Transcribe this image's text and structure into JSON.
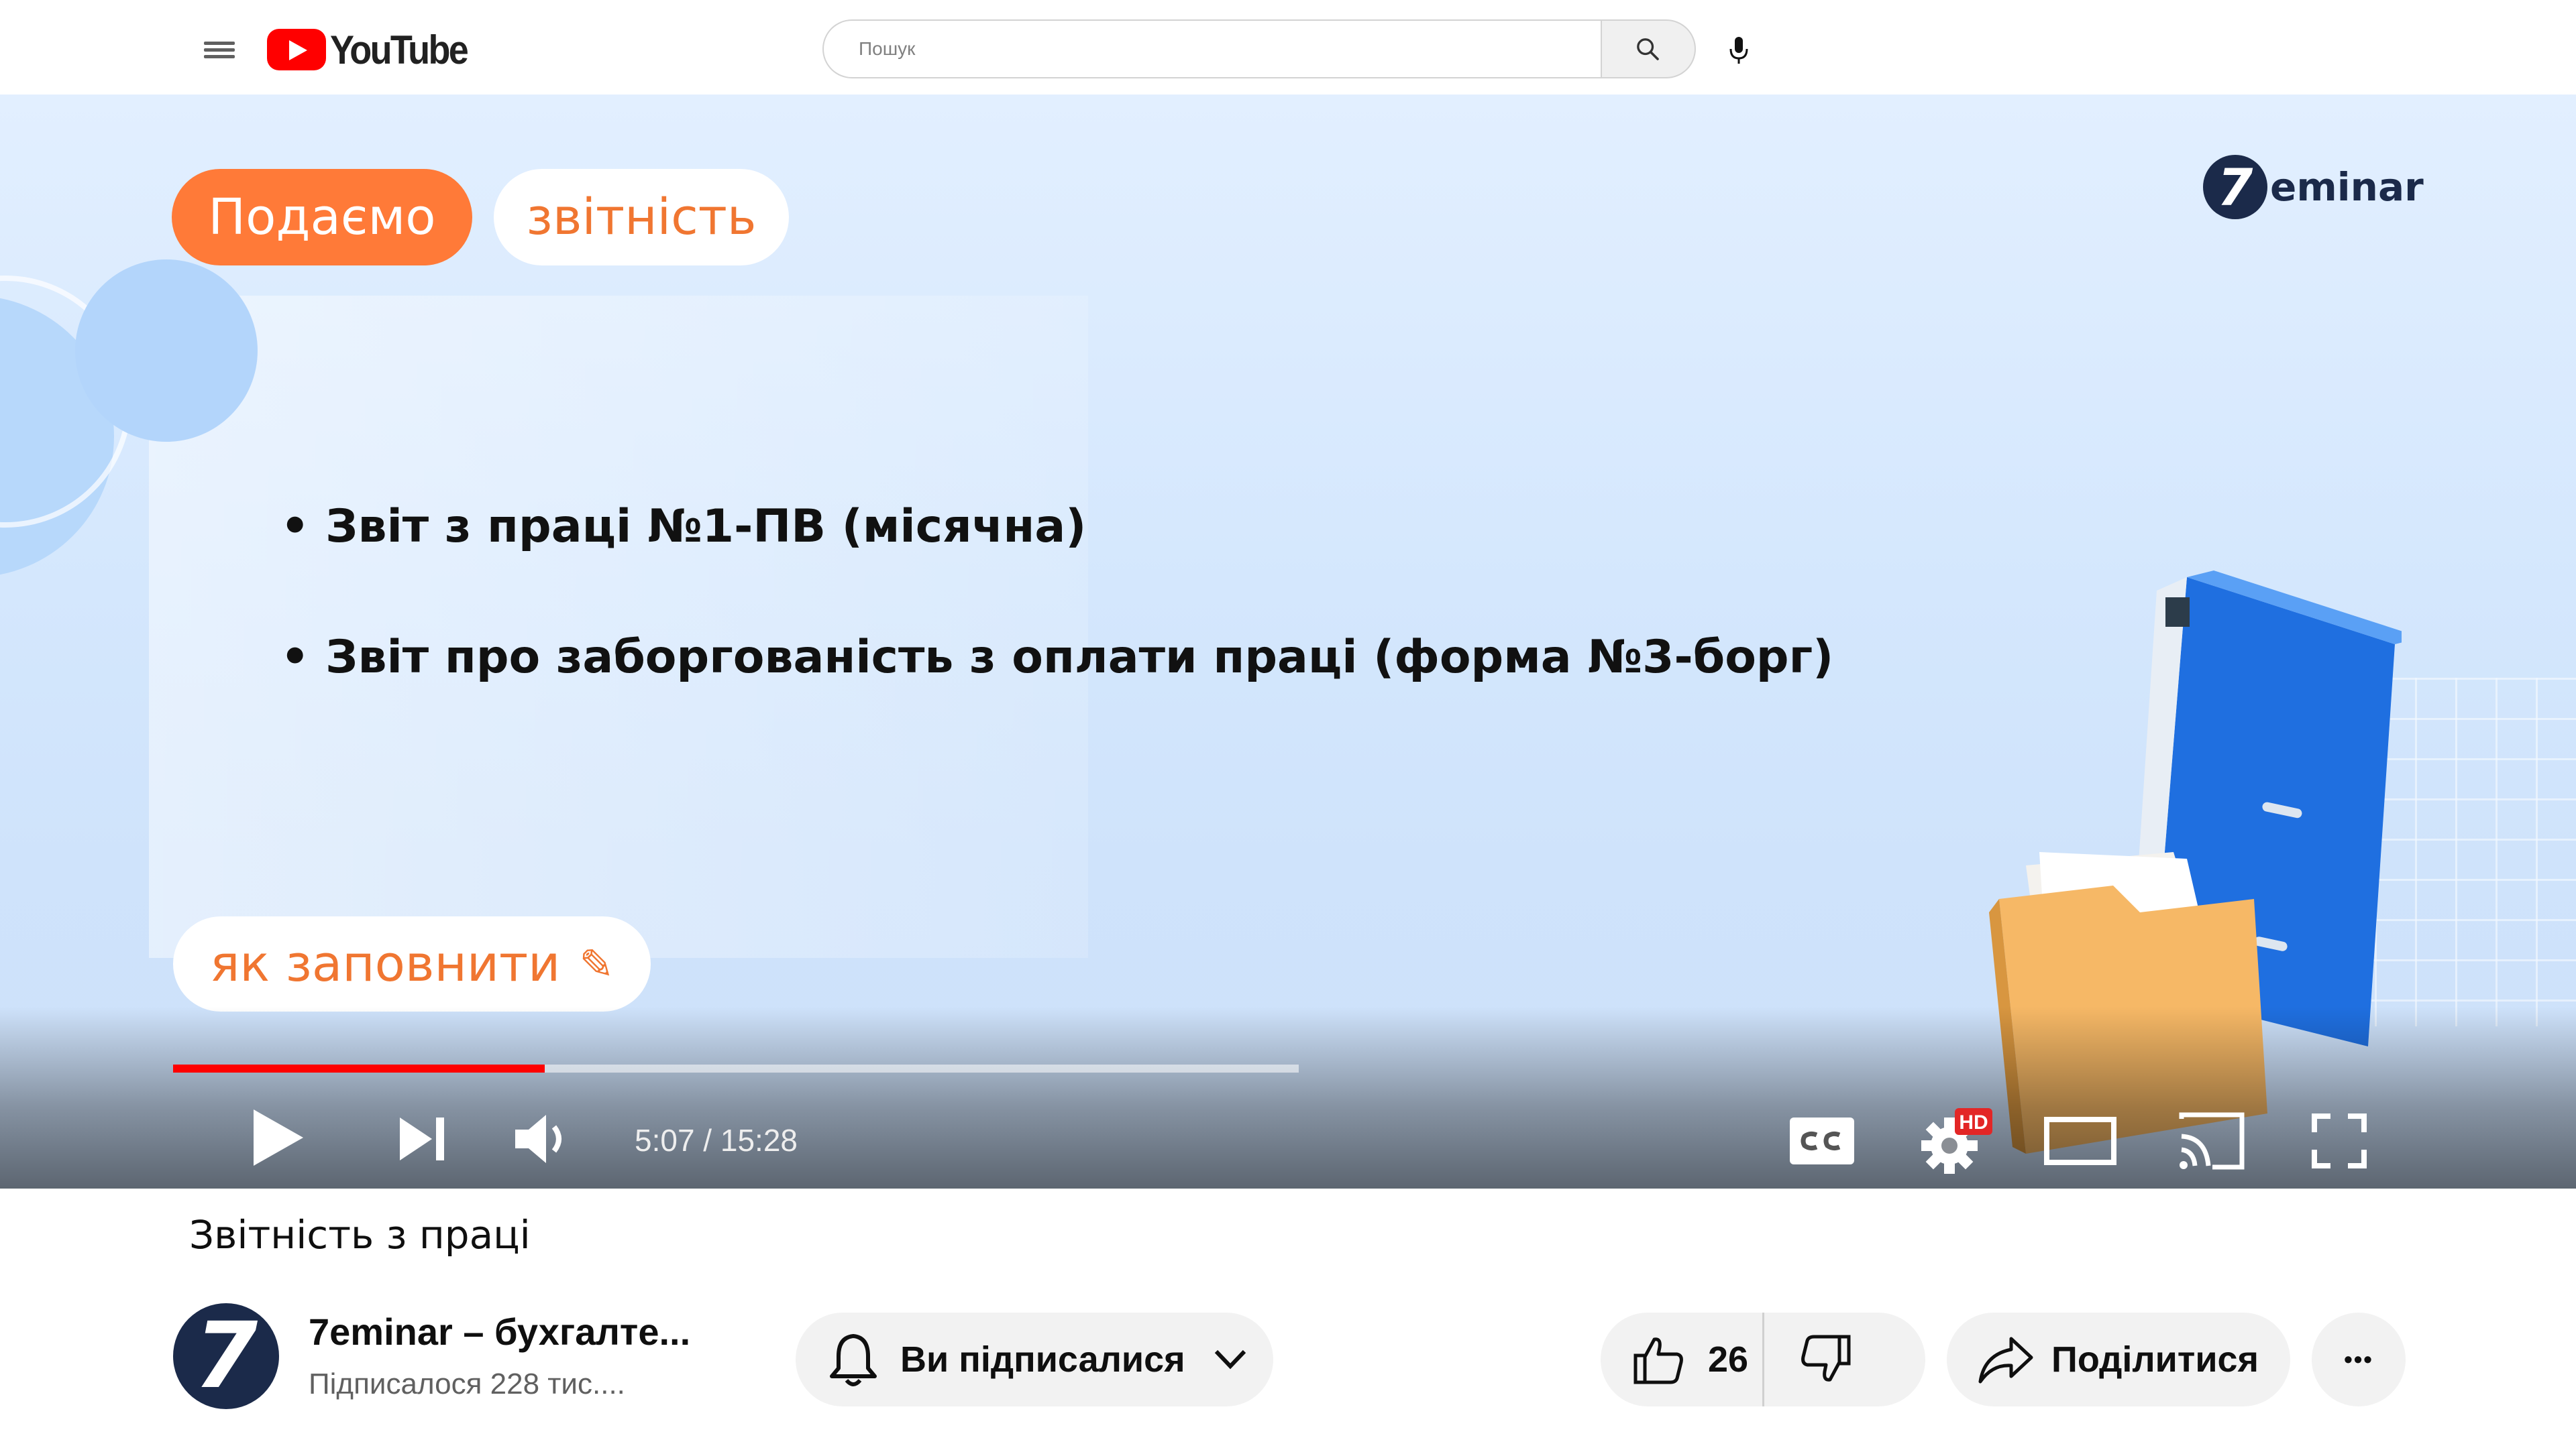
{
  "header": {
    "logo_text": "YouTube",
    "search_placeholder": "Пошук"
  },
  "player": {
    "slide": {
      "pill_submit": "Подаємо",
      "pill_reports": "звітність",
      "brand_digit": "7",
      "brand_word": "eminar",
      "bullets": [
        "• Звіт з праці №1-ПВ (місячна)",
        "• Звіт про заборгованість з оплати праці (форма №3-борг)"
      ],
      "how_to_fill": "як заповнити",
      "pencil_glyph": "✎"
    },
    "time_display": "5:07 / 15:28",
    "progress_fraction": 0.33,
    "hd_badge": "HD",
    "accent_color": "#ff0000"
  },
  "video": {
    "title": "Звітність з праці"
  },
  "channel": {
    "avatar_text": "7",
    "name": "7eminar – бухгалте...",
    "subscribers": "Підписалося 228 тис...."
  },
  "actions": {
    "subscribed_label": "Ви підписалися",
    "like_count": "26",
    "share_label": "Поділитися",
    "more_glyph": "•••"
  }
}
